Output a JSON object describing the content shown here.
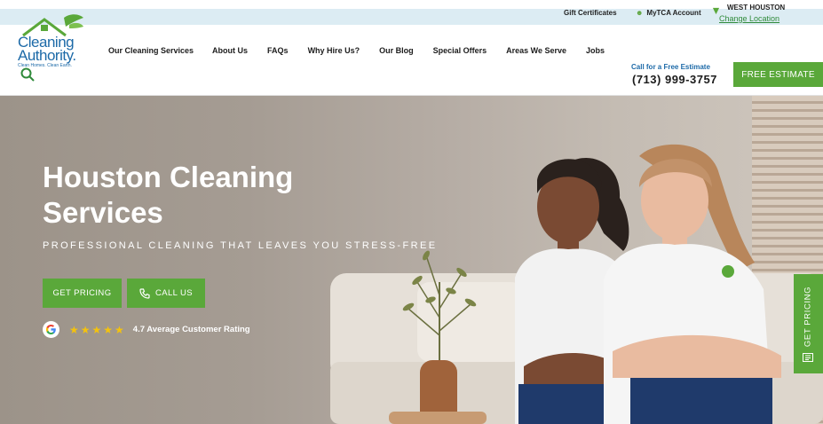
{
  "topbar": {
    "gift_certificates": "Gift Certificates",
    "account": "MyTCA Account",
    "location_city": "WEST HOUSTON",
    "change_location": "Change Location"
  },
  "header": {
    "logo": {
      "brand_line1": "Cleaning",
      "brand_line2": "Authority.",
      "tagline": "Clean Homes. Clean Earth."
    },
    "nav": [
      "Our Cleaning Services",
      "About Us",
      "FAQs",
      "Why Hire Us?",
      "Our Blog",
      "Special Offers",
      "Areas We Serve",
      "Jobs"
    ],
    "estimate_label": "Call for a Free Estimate",
    "phone": "(713) 999-3757",
    "free_estimate_button": "FREE ESTIMATE"
  },
  "hero": {
    "title": "Houston Cleaning Services",
    "subtitle": "PROFESSIONAL CLEANING THAT LEAVES YOU STRESS-FREE",
    "get_pricing_button": "GET PRICING",
    "call_us_button": "CALL US",
    "stars": "★★★★★",
    "rating_text": "4.7 Average Customer Rating"
  },
  "side_tab": {
    "label": "GET PRICING"
  },
  "colors": {
    "brand_green": "#5aa83a",
    "brand_blue": "#1d6aa8",
    "topbar_bg": "#dcecf3",
    "star_yellow": "#f4c20d"
  },
  "icons": [
    "search-icon",
    "account-icon",
    "location-pin-icon",
    "phone-icon",
    "google-icon",
    "calculator-icon"
  ]
}
